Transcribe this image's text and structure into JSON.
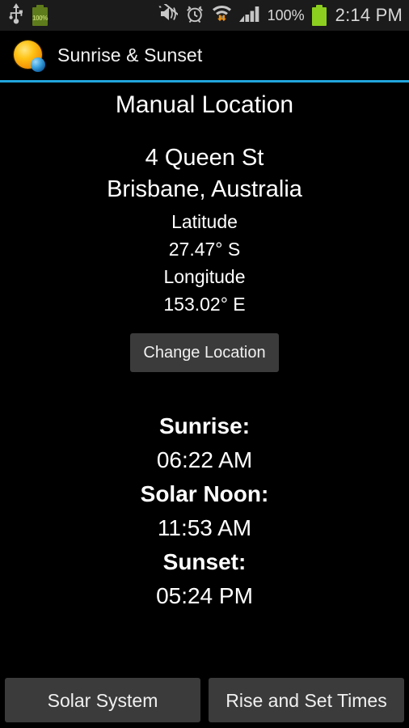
{
  "status_bar": {
    "usb_icon": "usb-icon",
    "charging_battery_icon": "battery-charging-icon",
    "charging_battery_label": "100%",
    "mute_icon": "vibrate-mute-icon",
    "alarm_icon": "alarm-clock-icon",
    "wifi_icon": "wifi-transfer-icon",
    "signal_icon": "cellular-signal-icon",
    "battery_percent": "100%",
    "battery_icon": "battery-full-icon",
    "clock": "2:14 PM"
  },
  "action_bar": {
    "app_icon": "sunrise-sunset-app-icon",
    "title": "Sunrise & Sunset",
    "divider_color": "#22a5dd"
  },
  "content": {
    "screen_title": "Manual Location",
    "address": {
      "street": "4 Queen St",
      "city_country": "Brisbane, Australia"
    },
    "coordinates": {
      "latitude_label": "Latitude",
      "latitude_value": "27.47° S",
      "longitude_label": "Longitude",
      "longitude_value": "153.02° E"
    },
    "change_location_label": "Change Location",
    "times": [
      {
        "label": "Sunrise:",
        "value": "06:22 AM"
      },
      {
        "label": "Solar Noon:",
        "value": "11:53 AM"
      },
      {
        "label": "Sunset:",
        "value": "05:24 PM"
      }
    ]
  },
  "bottom_bar": {
    "solar_system_label": "Solar System",
    "rise_set_label": "Rise and Set Times"
  }
}
